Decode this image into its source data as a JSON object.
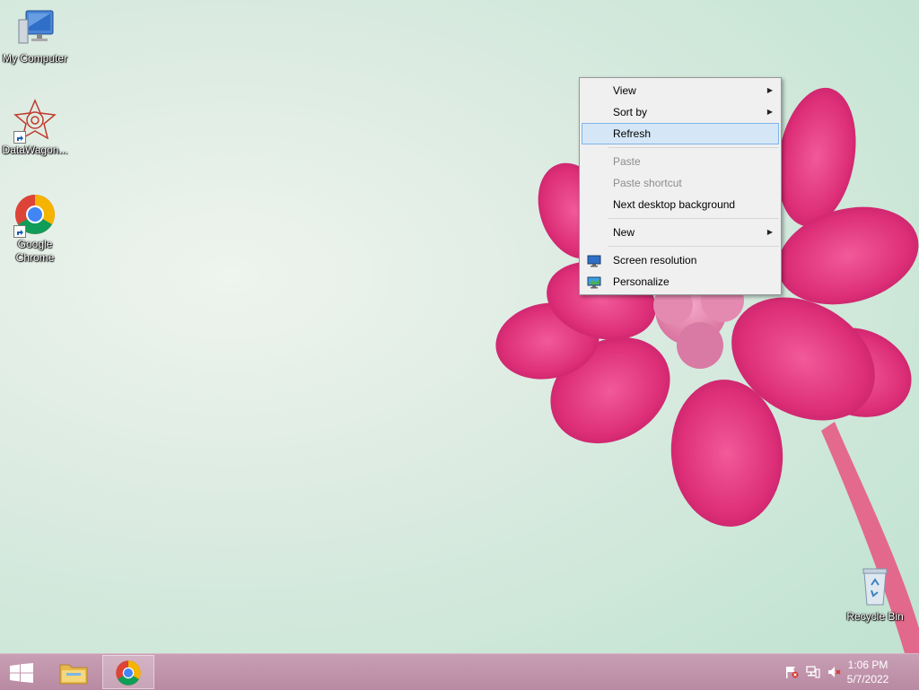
{
  "desktop": {
    "icons": [
      {
        "label": "My Computer"
      },
      {
        "label": "DataWagon..."
      },
      {
        "label": "Google Chrome"
      },
      {
        "label": "Recycle Bin"
      }
    ]
  },
  "context_menu": {
    "items": [
      {
        "label": "View",
        "submenu": true
      },
      {
        "label": "Sort by",
        "submenu": true
      },
      {
        "label": "Refresh",
        "highlighted": true
      },
      {
        "label": "Paste",
        "disabled": true
      },
      {
        "label": "Paste shortcut",
        "disabled": true
      },
      {
        "label": "Next desktop background"
      },
      {
        "label": "New",
        "submenu": true
      },
      {
        "label": "Screen resolution",
        "icon": "monitor-icon"
      },
      {
        "label": "Personalize",
        "icon": "personalize-icon"
      }
    ]
  },
  "taskbar": {
    "start": "windows-logo-icon",
    "pinned": [
      "file-explorer-icon",
      "chrome-icon"
    ],
    "tray": [
      "action-center-flag-icon",
      "network-icon",
      "volume-muted-icon"
    ],
    "clock": {
      "time": "1:06 PM",
      "date": "5/7/2022"
    }
  },
  "colors": {
    "taskbar": "#bf93aa",
    "menu_highlight": "#d5e7f7",
    "flower": "#e0307a"
  }
}
